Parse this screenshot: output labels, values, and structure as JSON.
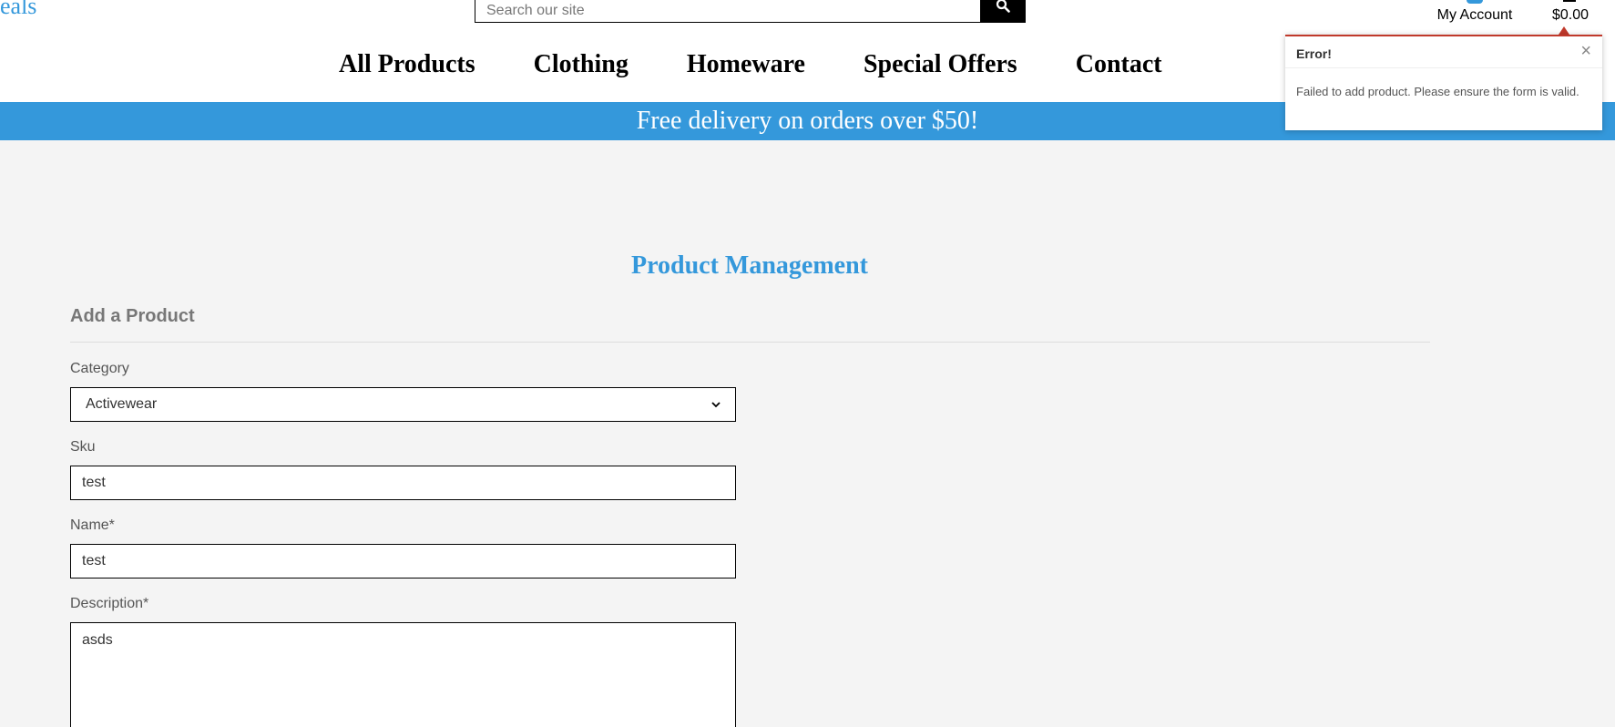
{
  "header": {
    "logo_text": "eals",
    "search": {
      "placeholder": "Search our site",
      "value": ""
    },
    "search_icon": "search-icon",
    "account": {
      "label": "My Account",
      "icon": "user-icon"
    },
    "cart": {
      "total": "$0.00",
      "icon": "cart-icon"
    }
  },
  "nav": {
    "items": [
      {
        "label": "All Products"
      },
      {
        "label": "Clothing"
      },
      {
        "label": "Homeware"
      },
      {
        "label": "Special Offers"
      },
      {
        "label": "Contact"
      }
    ]
  },
  "banner": {
    "text": "Free delivery on orders over $50!"
  },
  "main": {
    "page_title": "Product Management",
    "section_title": "Add a Product",
    "form": {
      "category": {
        "label": "Category",
        "value": "Activewear"
      },
      "sku": {
        "label": "Sku",
        "value": "test"
      },
      "name": {
        "label": "Name*",
        "value": "test"
      },
      "description": {
        "label": "Description*",
        "value": "asds"
      }
    }
  },
  "toast": {
    "title": "Error!",
    "close_label": "×",
    "message": "Failed to add product. Please ensure the form is valid."
  },
  "colors": {
    "accent": "#3498db",
    "error": "#c0392b",
    "page_background": "#f4f4f4"
  }
}
